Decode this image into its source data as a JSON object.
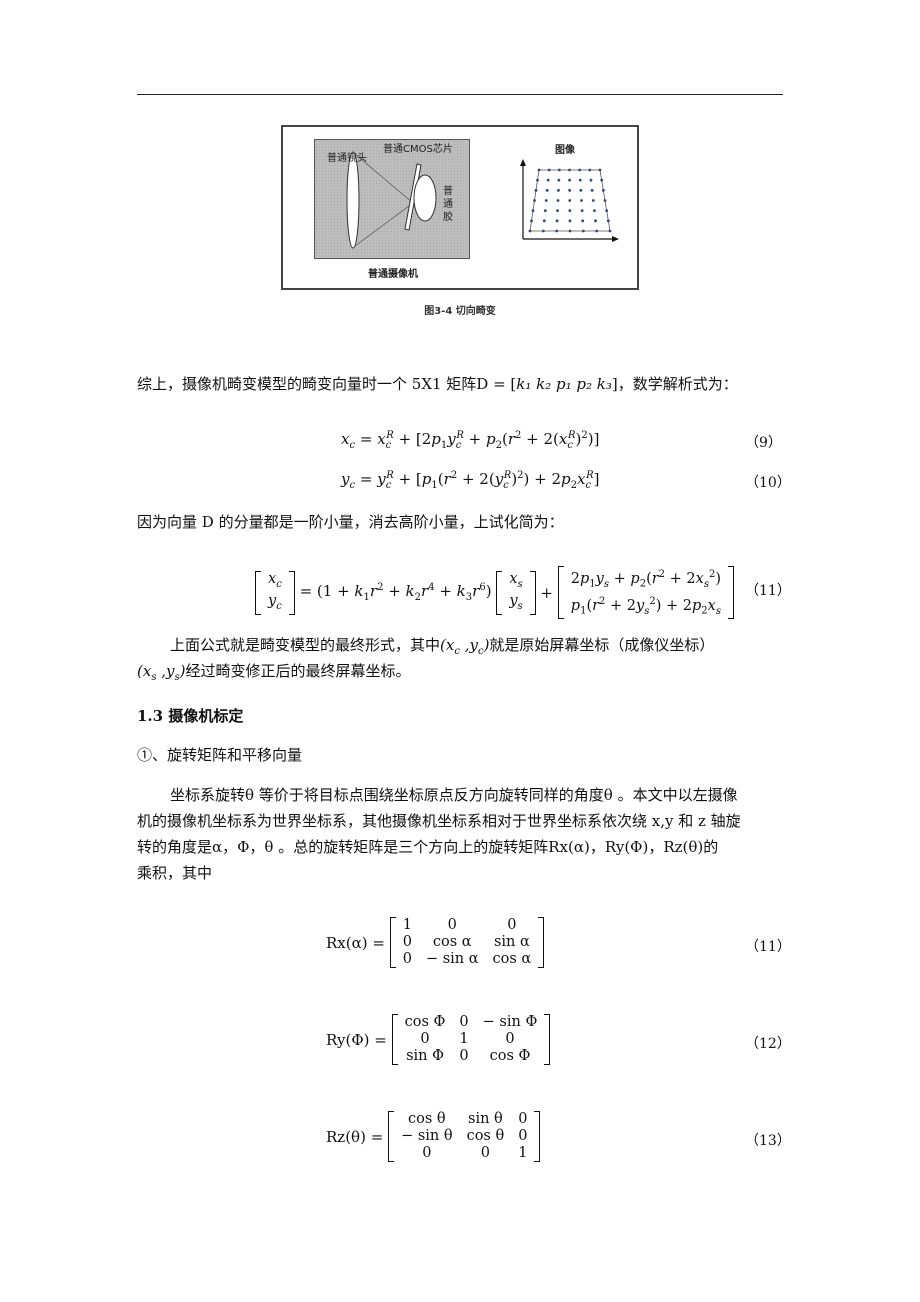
{
  "figure": {
    "labels": {
      "lens": "普通镜头",
      "cmos": "普通CMOS芯片",
      "film_1": "普",
      "film_2": "通",
      "film_3": "胶",
      "camera": "普通摄像机",
      "image": "图像"
    },
    "caption": "图3-4 切向畸变"
  },
  "paragraphs": {
    "p1_prefix": "综上，摄像机畸变模型的畸变向量时一个 5X1 矩阵D = [",
    "p1_vector": "k₁  k₂  p₁  p₂  k₃",
    "p1_suffix": "]，数学解析式为：",
    "p2": "因为向量 D 的分量都是一阶小量，消去高阶小量，上试化简为：",
    "p3_line1_a": "上面公式就是畸变模型的最终形式，其中",
    "p3_line1_math": "(xc ,yc)",
    "p3_line1_b": "就是原始屏幕坐标（成像仪坐标）",
    "p3_line2_math": "(xs ,ys)",
    "p3_line2_b": "经过畸变修正后的最终屏幕坐标。",
    "section_heading": "1.3 摄像机标定",
    "subheading": "①、旋转矩阵和平移向量",
    "p4_line1": "坐标系旋转θ 等价于将目标点围绕坐标原点反方向旋转同样的角度θ 。本文中以左摄像",
    "p4_line2": "机的摄像机坐标系为世界坐标系，其他摄像机坐标系相对于世界坐标系依次绕 x,y 和 z 轴旋",
    "p4_line3": "转的角度是α，Φ，θ 。总的旋转矩阵是三个方向上的旋转矩阵Rx(α)，Ry(Φ)，Rz(θ)的",
    "p4_line4": "乘积，其中"
  },
  "equations": [
    {
      "id": "eq9",
      "number": "（9）",
      "text": "x_c = x_c^R + [2p_1 y_c^R + p_2(r^2 + 2(x_c^R)^2)]"
    },
    {
      "id": "eq10",
      "number": "（10）",
      "text": "y_c = y_c^R + [p_1(r^2 + 2(y_c^R)^2) + 2p_2 x_c^R]"
    },
    {
      "id": "eq11a",
      "number": "（11）",
      "text": "[x_c; y_c] = (1 + k_1 r^2 + k_2 r^4 + k_3 r^6)[x_s; y_s] + [2p_1 y_s + p_2(r^2 + 2x_s^2); p_1(r^2 + 2y_s^2) + 2p_2 x_s]"
    },
    {
      "id": "eq11b",
      "number": "（11）",
      "lhs": "Rx(α) =",
      "matrix": [
        [
          "1",
          "0",
          "0"
        ],
        [
          "0",
          "cos α",
          "sin α"
        ],
        [
          "0",
          "− sin α",
          "cos α"
        ]
      ]
    },
    {
      "id": "eq12",
      "number": "（12）",
      "lhs": "Ry(Φ) =",
      "matrix": [
        [
          "cos Φ",
          "0",
          "− sin Φ"
        ],
        [
          "0",
          "1",
          "0"
        ],
        [
          "sin Φ",
          "0",
          "cos Φ"
        ]
      ]
    },
    {
      "id": "eq13",
      "number": "（13）",
      "lhs": "Rz(θ) =",
      "matrix": [
        [
          "cos θ",
          "sin θ",
          "0"
        ],
        [
          "− sin θ",
          "cos θ",
          "0"
        ],
        [
          "0",
          "0",
          "1"
        ]
      ]
    }
  ]
}
